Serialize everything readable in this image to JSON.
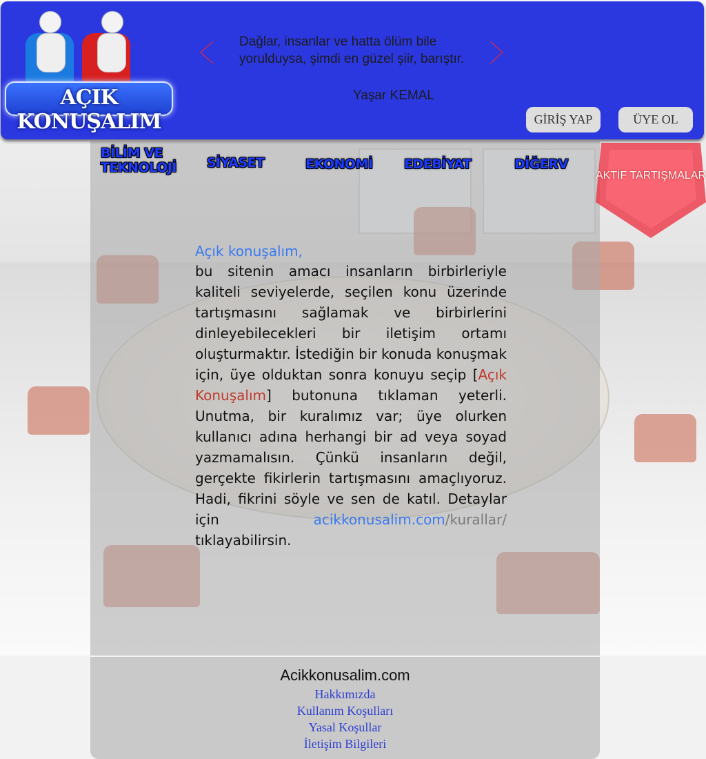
{
  "header": {
    "logo_text": "AÇIK KONUŞALIM",
    "quote": "Dağlar, insanlar ve hatta ölüm bile yorulduysa, şimdi en güzel şiir, barıştır.",
    "quote_author": "Yaşar KEMAL",
    "login_label": "GİRİŞ YAP",
    "signup_label": "ÜYE OL"
  },
  "nav": {
    "items": [
      {
        "label": "BİLİM VE TEKNOLOJİ"
      },
      {
        "label": "SİYASET"
      },
      {
        "label": "EKONOMİ"
      },
      {
        "label": "EDEBİYAT"
      },
      {
        "label": "DİĞER"
      }
    ],
    "more_glyph": "V",
    "active_label": "AKTİF TARTIŞMALAR"
  },
  "main": {
    "lead": "Açık konuşalım,",
    "p1": " bu sitenin amacı insanların birbirleriyle kaliteli seviyelerde, seçilen konu üzerinde tartışmasını sağlamak ve birbirlerini dinleyebilecekleri bir iletişim ortamı oluşturmaktır. İstediğin bir konuda konuş­mak için, üye olduktan sonra konuyu seçip ",
    "bracket_open": "[",
    "button_name": "Açık Konuşalım",
    "bracket_close": "]",
    "p2": " butonuna tıklam­an yeterli. Unutma, bir kuralımız var; üye olurken kullanıcı adına herhangi bir ad veya soyad yazmamalısın. Çünkü insan­ların değil, gerçekte fikirlerin tartışmasını amaçlıyoruz. Hadi, fikrini söyle ve sen de katıl. Detaylar için ",
    "link_domain": "acikkonusalim.com",
    "link_path": "/ku­rallar/",
    "p3": " tıklayabilirsin."
  },
  "footer": {
    "site": "Acikkonusalim.com",
    "links": [
      "Hakkımızda",
      "Kullanım Koşulları",
      "Yasal Koşullar",
      "İletişim Bilgileri"
    ]
  },
  "colors": {
    "header_bg": "#2b38e0",
    "nav_text": "#1d3bff",
    "badge": "#ee2a3c",
    "link": "#3a7af0",
    "highlight": "#c0392b",
    "footer_link": "#2e3fd2"
  },
  "icons": [
    "chevron-left-icon",
    "chevron-right-icon",
    "logo-figures"
  ]
}
